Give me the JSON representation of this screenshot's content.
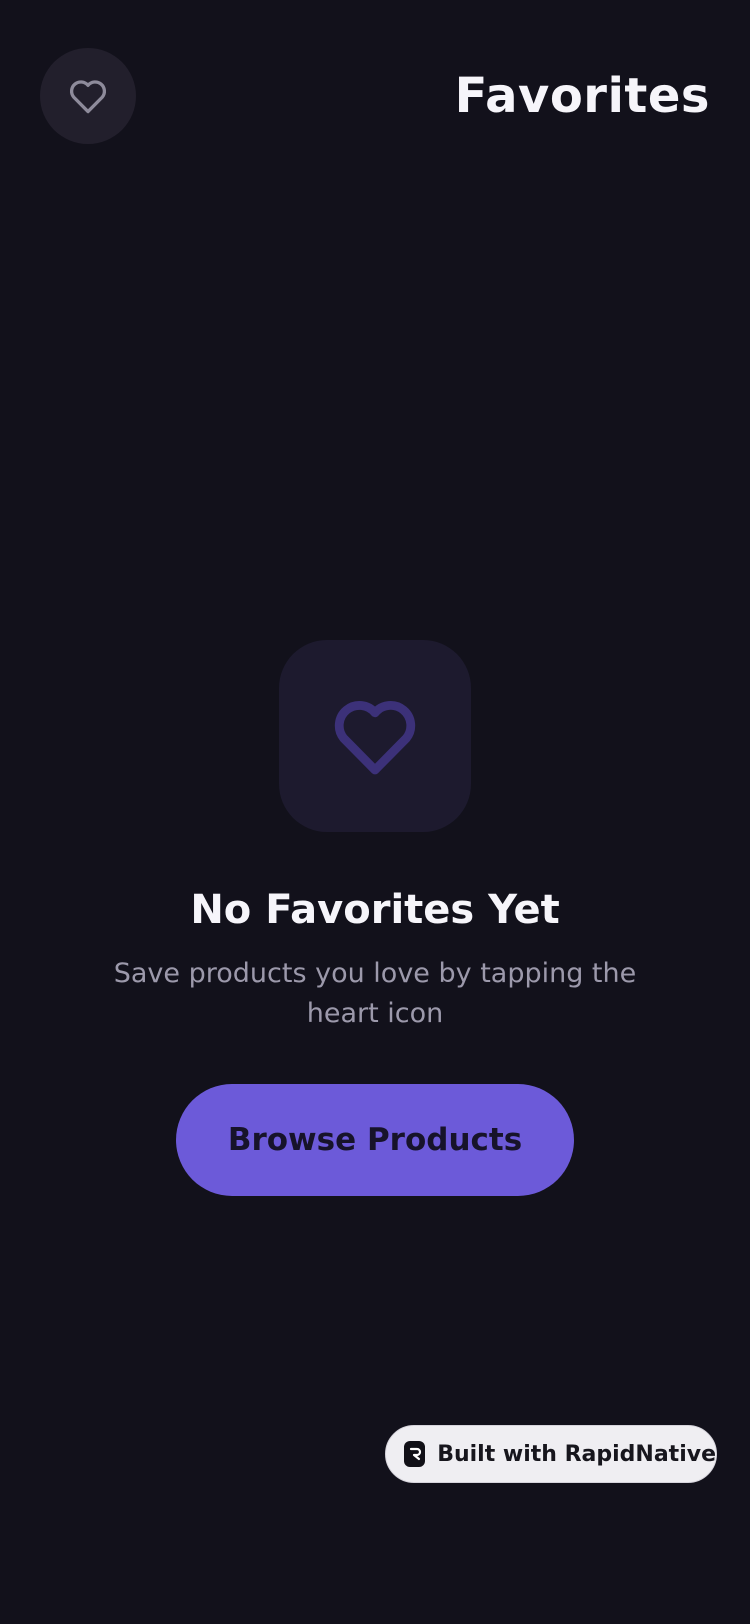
{
  "header": {
    "title": "Favorites",
    "heart_icon": "heart-outline-icon"
  },
  "empty_state": {
    "icon": "heart-outline-icon",
    "title": "No Favorites Yet",
    "subtitle": "Save products you love by tapping the heart icon",
    "button_label": "Browse Products"
  },
  "badge": {
    "logo_icon": "rapidnative-logo-icon",
    "label": "Built with RapidNative"
  },
  "colors": {
    "background": "#12111b",
    "accent": "#6c5ad9",
    "tile": "#1d1a2e",
    "icon_muted": "#3c3179",
    "header_button": "#221f2c"
  }
}
